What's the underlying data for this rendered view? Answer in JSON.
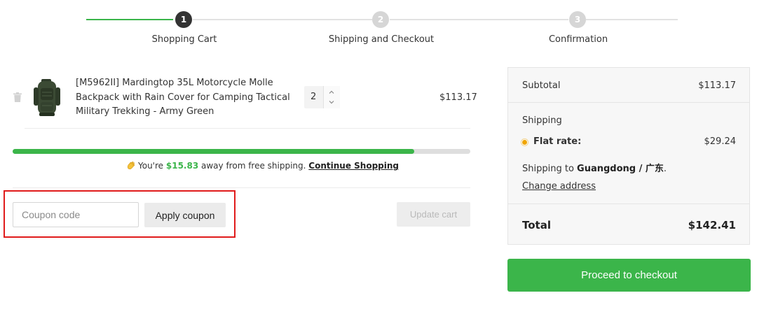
{
  "stepper": {
    "steps": [
      {
        "number": "1",
        "label": "Shopping Cart",
        "state": "active"
      },
      {
        "number": "2",
        "label": "Shipping and Checkout",
        "state": "pending"
      },
      {
        "number": "3",
        "label": "Confirmation",
        "state": "pending"
      }
    ]
  },
  "cart": {
    "item": {
      "name": "[M5962II] Mardingtop 35L Motorcycle Molle Backpack with Rain Cover for Camping Tactical Military Trekking - Army Green",
      "quantity": "2",
      "price": "$113.17",
      "thumbnail_icon": "backpack-image",
      "remove_icon": "trash-icon"
    },
    "free_shipping": {
      "progress_fraction": 0.878,
      "msg_prefix": "You're",
      "amount": "$15.83",
      "msg_suffix": "away from free shipping.",
      "link": "Continue Shopping",
      "icon": "waving-hand-emoji"
    },
    "coupon": {
      "placeholder": "Coupon code",
      "apply_label": "Apply coupon"
    },
    "update_label": "Update cart"
  },
  "totals": {
    "subtotal_label": "Subtotal",
    "subtotal_value": "$113.17",
    "shipping_label": "Shipping",
    "flat_rate_label": "Flat rate:",
    "flat_rate_value": "$29.24",
    "ship_to_prefix": "Shipping to",
    "ship_to_location": "Guangdong / 广东",
    "ship_to_suffix": ".",
    "change_address": "Change address",
    "total_label": "Total",
    "total_value": "$142.41"
  },
  "checkout_label": "Proceed to checkout",
  "colors": {
    "accent_green": "#3bb54a",
    "highlight_red": "#e01b1b",
    "flat_rate_dot": "#f0a500"
  }
}
